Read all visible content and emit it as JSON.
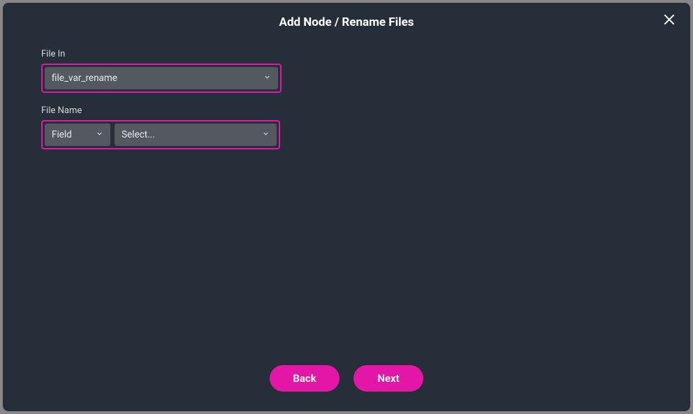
{
  "modal": {
    "title": "Add Node / Rename Files"
  },
  "fields": {
    "file_in": {
      "label": "File In",
      "value": "file_var_rename"
    },
    "file_name": {
      "label": "File Name",
      "type_value": "Field",
      "select_value": "Select..."
    }
  },
  "footer": {
    "back_label": "Back",
    "next_label": "Next"
  }
}
